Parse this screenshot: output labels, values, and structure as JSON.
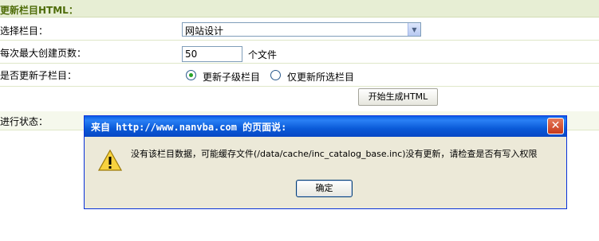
{
  "form": {
    "section_title": "更新栏目HTML：",
    "column_label": "选择栏目：",
    "column_value": "网站设计",
    "pages_label": "每次最大创建页数：",
    "pages_value": "50",
    "pages_unit": "个文件",
    "subcolumn_label": "是否更新子栏目：",
    "radio_update_sub": "更新子级栏目",
    "radio_update_selected": "仅更新所选栏目",
    "generate_button": "开始生成HTML",
    "status_label": "进行状态："
  },
  "dialog": {
    "title": "来自 http://www.nanvba.com 的页面说:",
    "message": "没有该栏目数据，可能缓存文件(/data/cache/inc_catalog_base.inc)没有更新，请检查是否有写入权限",
    "ok_label": "确定",
    "close_label": "✕"
  }
}
